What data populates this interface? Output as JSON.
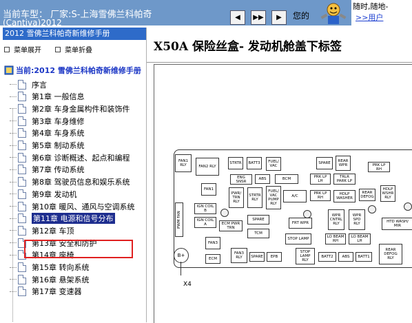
{
  "topbar": {
    "car_line1": "当前车型：  厂家:S-上海雪佛兰科帕奇",
    "car_line2": "(Cantiva)2012",
    "nav_buttons": [
      "◀",
      "▶▶",
      "▶"
    ],
    "youde": "您的",
    "ad_line1": "随时,随地-",
    "ad_line2": ">>用户"
  },
  "sidebar": {
    "manual_title": "2012 雪佛兰科帕奇新维修手册",
    "expand_label": "菜单展开",
    "collapse_label": "菜单折叠",
    "current_label": "当前:2012 雪佛兰科帕奇新维修手册",
    "items": [
      "序言",
      "第1章 一般信息",
      "第2章 车身金属构件和装饰件",
      "第3章 车身维修",
      "第4章 车身系统",
      "第5章 制动系统",
      "第6章 诊断概述、起点和编程",
      "第7章 传动系统",
      "第8章 驾驶员信息和娱乐系统",
      "第9章 发动机",
      "第10章 暖风、通风与空调系统",
      "第11章 电源和信号分布",
      "第12章 车顶",
      "第13章 安全和防护",
      "第14章 座椅",
      "第15章 转向系统",
      "第16章 悬架系统",
      "第17章 变速器"
    ],
    "selected_index": 11
  },
  "main": {
    "title": "X50A 保险丝盒- 发动机舱盖下标签",
    "fuses": {
      "fan1rly": "FAN1 RLY",
      "fan2rly": "FAN2 RLY",
      "strtr": "STRTR",
      "batt3": "BATT3",
      "fuelvac": "FUEL/ VAC",
      "spare1": "SPARE",
      "rearwpr": "REAR WPR",
      "prklprh": "PRK LP RH",
      "engsnsr": "ENG SNSR",
      "abs1": "ABS",
      "bcm": "BCM",
      "prklplh": "PRK LP LH",
      "trlrprk": "TRLR PARK LP",
      "fan1": "FAN1",
      "pwrtrnrly": "PWR/ TRN RLY",
      "strtrrly": "STRTR RLY",
      "fuelpumprly": "FUEL/ VAC PUMP RLY",
      "ac": "A/C",
      "prklprh2": "PRK LP RH",
      "hdlpwasher": "HDLP WASHER",
      "reardefog": "REAR DEFOG",
      "hdlpwshr": "HDLP WSHR RLY",
      "pwmfan": "PWM FAN",
      "igncoilb": "IGN COIL B",
      "igncoila": "IGN COIL A",
      "ecmpwr": "ECM PWR TRN",
      "spare2": "SPARE",
      "frtwpr": "FRT WPR",
      "wprcntrl": "WPR CNTRL RLY",
      "wprspd": "WPR SPD RLY",
      "htdwash": "HTD WASH/ MIR",
      "tcm": "TCM",
      "stoplamp": "STOP LAMP",
      "lobeamrh": "LO BEAM RH",
      "lobeamlh": "LO BEAM LH",
      "fan3": "FAN3",
      "ecm": "ECM",
      "fan3rly": "FAN3 RLY",
      "spare3": "SPARE",
      "epb": "EPB",
      "stoplamprly": "STOP LAMP RLY",
      "batt2": "BATT2",
      "abs2": "ABS",
      "batt1": "BATT1",
      "reardefogrly": "REAR DEFOG RLY",
      "bplus": "B+"
    },
    "x4_label": "X4"
  }
}
